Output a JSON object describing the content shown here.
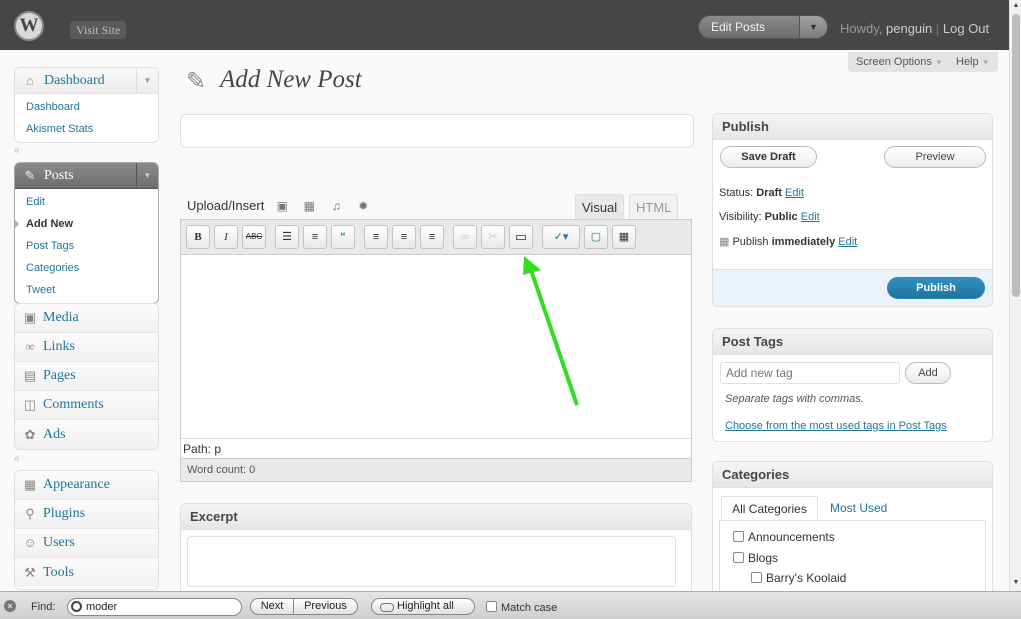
{
  "header": {
    "logo": "W",
    "visit_site": "Visit Site",
    "favorite_action": "Edit Posts",
    "favorite_arrow": "▼",
    "howdy_prefix": "Howdy, ",
    "username": "penguin",
    "separator": " | ",
    "logout": "Log Out"
  },
  "sidebar": {
    "dashboard": {
      "label": "Dashboard",
      "items": [
        "Dashboard",
        "Akismet Stats"
      ]
    },
    "posts": {
      "label": "Posts",
      "items": [
        "Edit",
        "Add New",
        "Post Tags",
        "Categories",
        "Tweet"
      ]
    },
    "menu": [
      "Media",
      "Links",
      "Pages",
      "Comments",
      "Ads"
    ],
    "menu2": [
      "Appearance",
      "Plugins",
      "Users",
      "Tools"
    ]
  },
  "top_tabs": {
    "screen_options": "Screen Options",
    "help": "Help"
  },
  "page": {
    "title": "Add New Post"
  },
  "editor": {
    "upload_insert": "Upload/Insert",
    "tab_visual": "Visual",
    "tab_html": "HTML",
    "toolbar": {
      "bold": "B",
      "italic": "I",
      "strike": "ABC"
    },
    "path_label": "Path: p",
    "word_count": "Word count: 0"
  },
  "excerpt": {
    "title": "Excerpt"
  },
  "publish": {
    "title": "Publish",
    "save_draft": "Save Draft",
    "preview": "Preview",
    "status_label": "Status: ",
    "status_value": "Draft",
    "visibility_label": "Visibility: ",
    "visibility_value": "Public",
    "publish_label": "Publish ",
    "publish_value": "immediately",
    "edit": "Edit",
    "publish_button": "Publish"
  },
  "post_tags": {
    "title": "Post Tags",
    "placeholder": "Add new tag",
    "add": "Add",
    "hint": "Separate tags with commas.",
    "choose": "Choose from the most used tags in Post Tags"
  },
  "categories": {
    "title": "Categories",
    "tab_all": "All Categories",
    "tab_most": "Most Used",
    "items": [
      "Announcements",
      "Blogs",
      "Barry's Koolaid"
    ]
  },
  "findbar": {
    "label": "Find:",
    "query": "moder",
    "next": "Next",
    "previous": "Previous",
    "highlight_all": "Highlight all",
    "match_case": "Match case"
  },
  "colors": {
    "header_bg": "#464646",
    "link": "#21759b",
    "publish_button": "#21759b",
    "annotation_arrow": "#33dd22"
  }
}
